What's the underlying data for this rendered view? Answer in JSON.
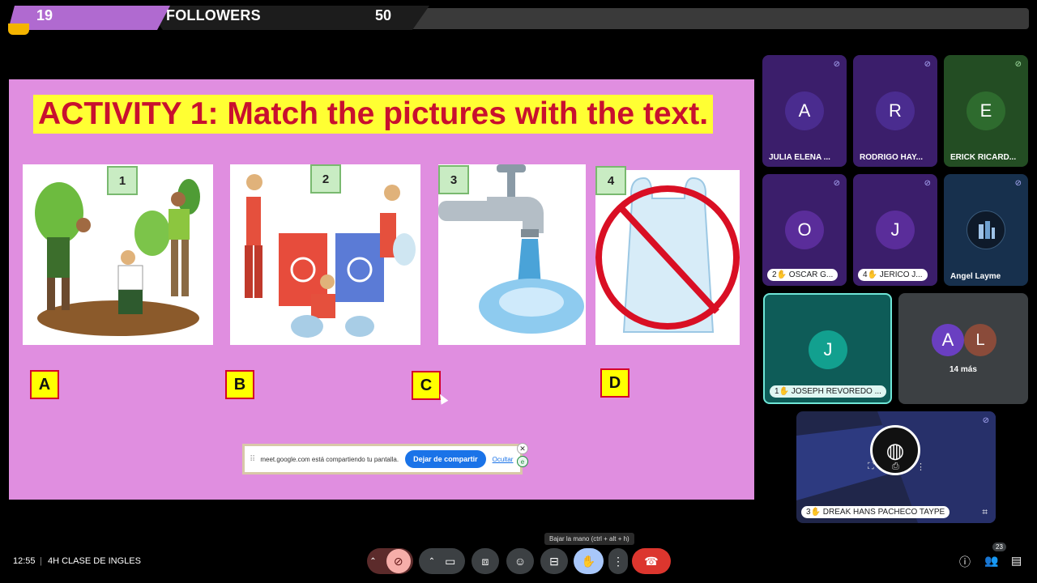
{
  "top_overlay": {
    "left_number": "19",
    "label": "FOLLOWERS",
    "right_number": "50"
  },
  "slide": {
    "title": "ACTIVITY 1: Match the pictures with the text.",
    "pictures": [
      {
        "number": "1",
        "icon": "tree-planting-illustration"
      },
      {
        "number": "2",
        "icon": "recycling-illustration"
      },
      {
        "number": "3",
        "icon": "running-tap-illustration"
      },
      {
        "number": "4",
        "icon": "no-plastic-bag-illustration"
      }
    ],
    "letters": [
      "A",
      "B",
      "C",
      "D"
    ]
  },
  "share_bar": {
    "message": "meet.google.com está compartiendo tu pantalla.",
    "stop_label": "Dejar de compartir",
    "hide_label": "Ocultar"
  },
  "participants": [
    {
      "initial": "A",
      "name": "JULIA ELENA ...",
      "color": "#4a2c8f",
      "bg": "#3b1e6b",
      "muted": true
    },
    {
      "initial": "R",
      "name": "RODRIGO HAY...",
      "color": "#4a2c8f",
      "bg": "#3b1e6b",
      "muted": true
    },
    {
      "initial": "E",
      "name": "ERICK RICARD...",
      "color": "#2e6b2e",
      "bg": "#234d23",
      "muted": true
    },
    {
      "initial": "O",
      "name": "OSCAR G...",
      "hand": "2",
      "color": "#5a2d9a",
      "bg": "#3b1e6b",
      "muted": true
    },
    {
      "initial": "J",
      "name": "JERICO J...",
      "hand": "4",
      "color": "#5a2d9a",
      "bg": "#3b1e6b",
      "muted": true
    },
    {
      "initial": "",
      "name": "Angel Layme",
      "color": "#1f3a5a",
      "bg": "#17304d",
      "muted": true
    },
    {
      "initial": "J",
      "name": "JOSEPH REVOREDO ...",
      "hand": "1",
      "color": "#12a08f",
      "bg": "#0e5c58",
      "muted": false
    },
    {
      "initial": "",
      "name": "DREAK HANS PACHECO TAYPE",
      "hand": "3",
      "muted": true
    }
  ],
  "more_tile": {
    "avatars": [
      "A",
      "L"
    ],
    "label": "14 más"
  },
  "toolbar": {
    "time": "12:55",
    "separator": "|",
    "meeting_name": "4H CLASE DE INGLES",
    "tooltip": "Bajar la mano (ctrl + alt + h)",
    "people_count": "23"
  }
}
